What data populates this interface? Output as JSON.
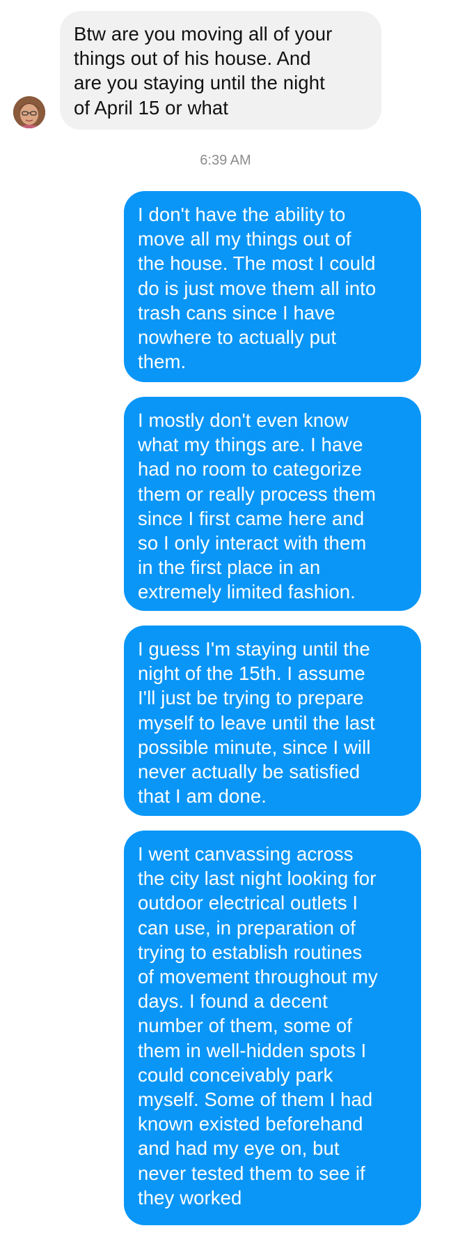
{
  "thread": {
    "incoming": {
      "avatar_icon": "user-avatar-icon",
      "text": "Btw are you moving all of your\nthings out of his house. And\nare you staying until the night\nof April 15 or what"
    },
    "timestamp": "6:39 AM",
    "outgoing": [
      {
        "text": "I don't have the ability to\nmove all my things out of\nthe house. The most I could\ndo is just move them all into\ntrash cans since I have\nnowhere to actually put\nthem."
      },
      {
        "text": "I mostly don't even know\nwhat my things are. I have\nhad no room to categorize\nthem or really process them\nsince I first came here and\nso I only interact with them\nin the first place in an\nextremely limited fashion."
      },
      {
        "text": "I guess I'm staying until the\nnight of the 15th. I assume\nI'll just be trying to prepare\nmyself to leave until the last\npossible minute, since I will\nnever actually be satisfied\nthat I am done."
      },
      {
        "text": "I went canvassing across\nthe city last night looking for\noutdoor electrical outlets I\ncan use, in preparation of\ntrying to establish routines\nof movement throughout my\ndays. I found a decent\nnumber of them, some of\nthem in well-hidden spots I\ncould conceivably park\nmyself. Some of them I had\nknown existed beforehand\nand had my eye on, but\nnever tested them to see if\nthey worked"
      }
    ]
  },
  "colors": {
    "incoming_bubble": "#f1f1f1",
    "outgoing_bubble": "#0a96f7",
    "timestamp_text": "#8c8c8c"
  }
}
